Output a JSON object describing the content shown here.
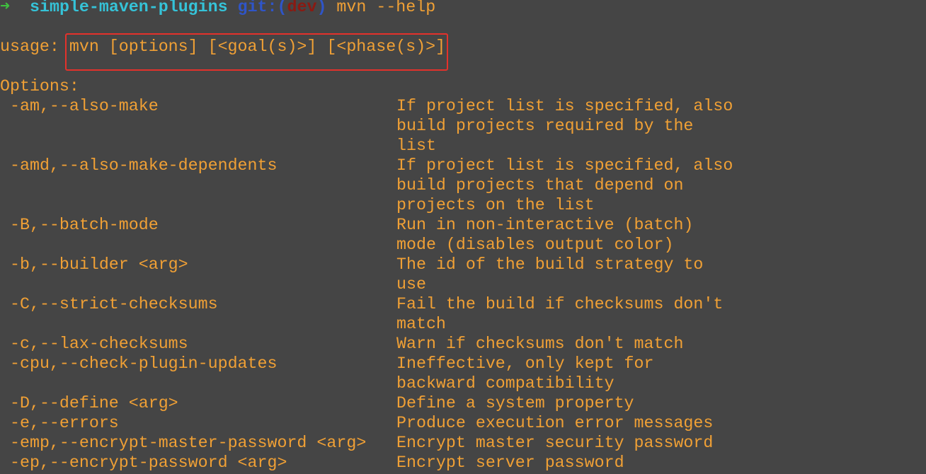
{
  "prompt": {
    "arrow": "➜",
    "directory": "simple-maven-plugins",
    "git_label": "git:",
    "paren_open": "(",
    "branch": "dev",
    "paren_close": ")",
    "command": "mvn --help"
  },
  "usage": {
    "label": "usage:",
    "syntax": "mvn [options] [<goal(s)>] [<phase(s)>]"
  },
  "options_heading": "Options:",
  "options": [
    {
      "flag": "-am,--also-make",
      "desc": [
        "If project list is specified, also",
        "build projects required by the",
        "list"
      ]
    },
    {
      "flag": "-amd,--also-make-dependents",
      "desc": [
        "If project list is specified, also",
        "build projects that depend on",
        "projects on the list"
      ]
    },
    {
      "flag": "-B,--batch-mode",
      "desc": [
        "Run in non-interactive (batch)",
        "mode (disables output color)"
      ]
    },
    {
      "flag": "-b,--builder <arg>",
      "desc": [
        "The id of the build strategy to",
        "use"
      ]
    },
    {
      "flag": "-C,--strict-checksums",
      "desc": [
        "Fail the build if checksums don't",
        "match"
      ]
    },
    {
      "flag": "-c,--lax-checksums",
      "desc": [
        "Warn if checksums don't match"
      ]
    },
    {
      "flag": "-cpu,--check-plugin-updates",
      "desc": [
        "Ineffective, only kept for",
        "backward compatibility"
      ]
    },
    {
      "flag": "-D,--define <arg>",
      "desc": [
        "Define a system property"
      ]
    },
    {
      "flag": "-e,--errors",
      "desc": [
        "Produce execution error messages"
      ]
    },
    {
      "flag": "-emp,--encrypt-master-password <arg>",
      "desc": [
        "Encrypt master security password"
      ]
    },
    {
      "flag": "-ep,--encrypt-password <arg>",
      "desc": [
        "Encrypt server password"
      ]
    }
  ],
  "colors": {
    "background": "#454545",
    "text": "#f0a035",
    "arrow": "#3fbf3f",
    "directory": "#35c3d8",
    "git": "#2f55c8",
    "branch": "#8a1a12",
    "highlight_box": "#e4312b"
  }
}
